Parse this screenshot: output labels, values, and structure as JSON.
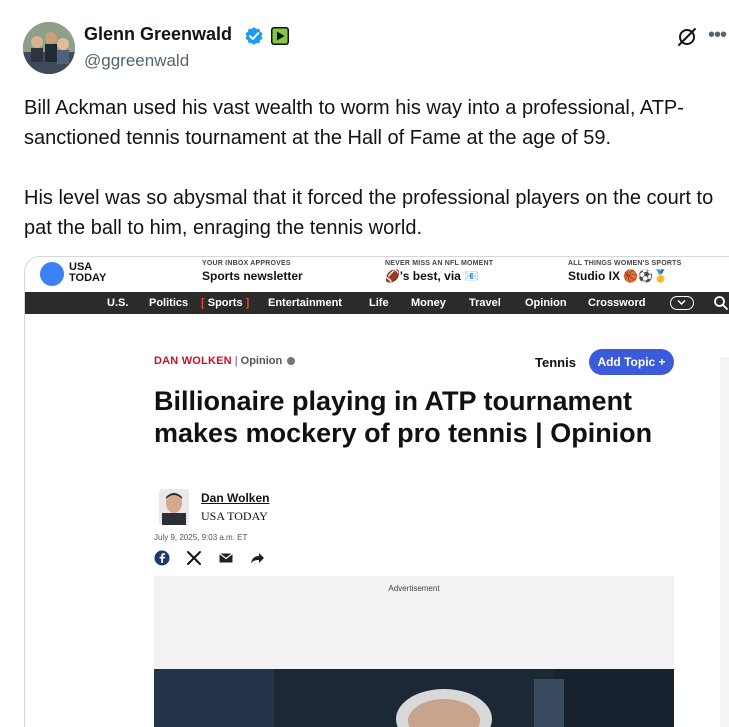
{
  "tweet": {
    "author_name": "Glenn Greenwald",
    "handle": "@ggreenwald",
    "text_paragraph_1": "Bill Ackman used his vast wealth to worm his way into a professional, ATP-sanctioned tennis tournament at the Hall of Fame at the age of 59.",
    "text_paragraph_2": "His level was so abysmal that it forced the professional players on the court to pat the ball to him, enraging the tennis world.",
    "icons": [
      "verified-badge-icon",
      "rumble-affiliate-icon",
      "grok-icon",
      "more-icon"
    ],
    "colors": {
      "verified": "#1d9bf0",
      "affiliate": "#85c742"
    }
  },
  "article": {
    "logo": "USA TODAY",
    "promos": [
      {
        "kicker": "YOUR INBOX APPROVES",
        "title": "Sports newsletter"
      },
      {
        "kicker": "NEVER MISS AN NFL MOMENT",
        "title": "🏈's best, via 📧"
      },
      {
        "kicker": "ALL THINGS WOMEN'S SPORTS",
        "title": "Studio IX 🏀⚽🥇"
      }
    ],
    "nav": [
      "U.S.",
      "Politics",
      "Sports",
      "Entertainment",
      "Life",
      "Money",
      "Travel",
      "Opinion",
      "Crossword"
    ],
    "active_nav": "Sports",
    "byline_author": "DAN WOLKEN",
    "byline_section": "Opinion",
    "topic_label": "Tennis",
    "add_topic_label": "Add Topic +",
    "headline": "Billionaire playing in ATP tournament makes mockery of pro tennis | Opinion",
    "author_link": "Dan Wolken",
    "author_org": "USA TODAY",
    "date": "July 9, 2025, 9:03 a.m. ET",
    "ad_label": "Advertisement",
    "colors": {
      "nav_bg": "#2b2b2b",
      "byline_red": "#c8102e",
      "topic_button": "#3b5bdb",
      "logo_blue": "#3b82f6"
    }
  }
}
